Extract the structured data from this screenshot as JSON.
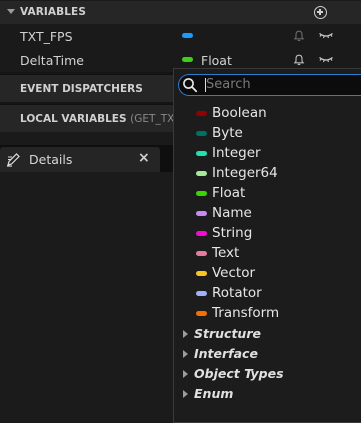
{
  "variables_section": {
    "title": "VARIABLES"
  },
  "variables": [
    {
      "name": "TXT_FPS",
      "type_label": "",
      "type_color": "#1a9bff"
    },
    {
      "name": "DeltaTime",
      "type_label": "Float",
      "type_color": "#3fcf1a"
    }
  ],
  "event_dispatchers": {
    "title": "EVENT DISPATCHERS"
  },
  "local_variables": {
    "title": "LOCAL VARIABLES",
    "hint": "(GET_TXT_"
  },
  "details_tab": {
    "label": "Details",
    "close": "×"
  },
  "type_picker": {
    "search_placeholder": "Search",
    "types": [
      {
        "label": "Boolean",
        "color": "#8c0303"
      },
      {
        "label": "Byte",
        "color": "#006f64"
      },
      {
        "label": "Integer",
        "color": "#1fe3af"
      },
      {
        "label": "Integer64",
        "color": "#a8e89c"
      },
      {
        "label": "Float",
        "color": "#38d500"
      },
      {
        "label": "Name",
        "color": "#c88af2"
      },
      {
        "label": "String",
        "color": "#f30bd2"
      },
      {
        "label": "Text",
        "color": "#e07e9b"
      },
      {
        "label": "Vector",
        "color": "#f8c624"
      },
      {
        "label": "Rotator",
        "color": "#9fb0fd"
      },
      {
        "label": "Transform",
        "color": "#f36f00"
      }
    ],
    "categories": [
      {
        "label": "Structure"
      },
      {
        "label": "Interface"
      },
      {
        "label": "Object Types"
      },
      {
        "label": "Enum"
      }
    ]
  }
}
